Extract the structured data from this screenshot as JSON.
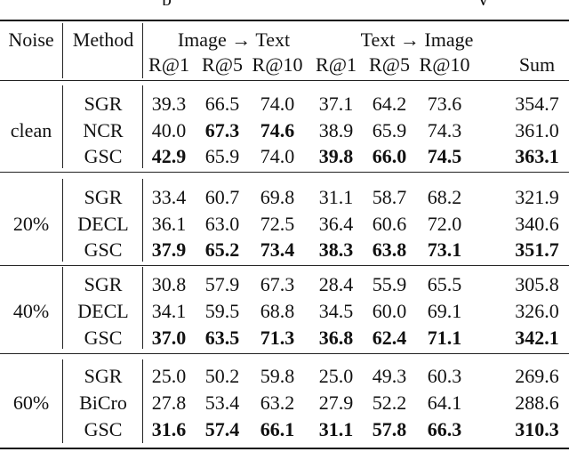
{
  "table": {
    "header": {
      "noise_label": "Noise",
      "method_label": "Method",
      "group_image_to_text": "Image → Text",
      "group_text_to_image": "Text → Image",
      "columns": [
        "R@1",
        "R@5",
        "R@10",
        "R@1",
        "R@5",
        "R@10",
        "Sum"
      ]
    },
    "sections": [
      {
        "noise": "clean",
        "rows": [
          {
            "method": "SGR",
            "values": [
              "39.3",
              "66.5",
              "74.0",
              "37.1",
              "64.2",
              "73.6",
              "354.7"
            ],
            "bold": [
              false,
              false,
              false,
              false,
              false,
              false,
              false
            ]
          },
          {
            "method": "NCR",
            "values": [
              "40.0",
              "67.3",
              "74.6",
              "38.9",
              "65.9",
              "74.3",
              "361.0"
            ],
            "bold": [
              false,
              true,
              true,
              false,
              false,
              false,
              false
            ]
          },
          {
            "method": "GSC",
            "values": [
              "42.9",
              "65.9",
              "74.0",
              "39.8",
              "66.0",
              "74.5",
              "363.1"
            ],
            "bold": [
              true,
              false,
              false,
              true,
              true,
              true,
              true
            ]
          }
        ]
      },
      {
        "noise": "20%",
        "rows": [
          {
            "method": "SGR",
            "values": [
              "33.4",
              "60.7",
              "69.8",
              "31.1",
              "58.7",
              "68.2",
              "321.9"
            ],
            "bold": [
              false,
              false,
              false,
              false,
              false,
              false,
              false
            ]
          },
          {
            "method": "DECL",
            "values": [
              "36.1",
              "63.0",
              "72.5",
              "36.4",
              "60.6",
              "72.0",
              "340.6"
            ],
            "bold": [
              false,
              false,
              false,
              false,
              false,
              false,
              false
            ]
          },
          {
            "method": "GSC",
            "values": [
              "37.9",
              "65.2",
              "73.4",
              "38.3",
              "63.8",
              "73.1",
              "351.7"
            ],
            "bold": [
              true,
              true,
              true,
              true,
              true,
              true,
              true
            ]
          }
        ]
      },
      {
        "noise": "40%",
        "rows": [
          {
            "method": "SGR",
            "values": [
              "30.8",
              "57.9",
              "67.3",
              "28.4",
              "55.9",
              "65.5",
              "305.8"
            ],
            "bold": [
              false,
              false,
              false,
              false,
              false,
              false,
              false
            ]
          },
          {
            "method": "DECL",
            "values": [
              "34.1",
              "59.5",
              "68.8",
              "34.5",
              "60.0",
              "69.1",
              "326.0"
            ],
            "bold": [
              false,
              false,
              false,
              false,
              false,
              false,
              false
            ]
          },
          {
            "method": "GSC",
            "values": [
              "37.0",
              "63.5",
              "71.3",
              "36.8",
              "62.4",
              "71.1",
              "342.1"
            ],
            "bold": [
              true,
              true,
              true,
              true,
              true,
              true,
              true
            ]
          }
        ]
      },
      {
        "noise": "60%",
        "rows": [
          {
            "method": "SGR",
            "values": [
              "25.0",
              "50.2",
              "59.8",
              "25.0",
              "49.3",
              "60.3",
              "269.6"
            ],
            "bold": [
              false,
              false,
              false,
              false,
              false,
              false,
              false
            ]
          },
          {
            "method": "BiCro",
            "values": [
              "27.8",
              "53.4",
              "63.2",
              "27.9",
              "52.2",
              "64.1",
              "288.6"
            ],
            "bold": [
              false,
              false,
              false,
              false,
              false,
              false,
              false
            ]
          },
          {
            "method": "GSC",
            "values": [
              "31.6",
              "57.4",
              "66.1",
              "31.1",
              "57.8",
              "66.3",
              "310.3"
            ],
            "bold": [
              true,
              true,
              true,
              true,
              true,
              true,
              true
            ]
          }
        ]
      }
    ]
  }
}
